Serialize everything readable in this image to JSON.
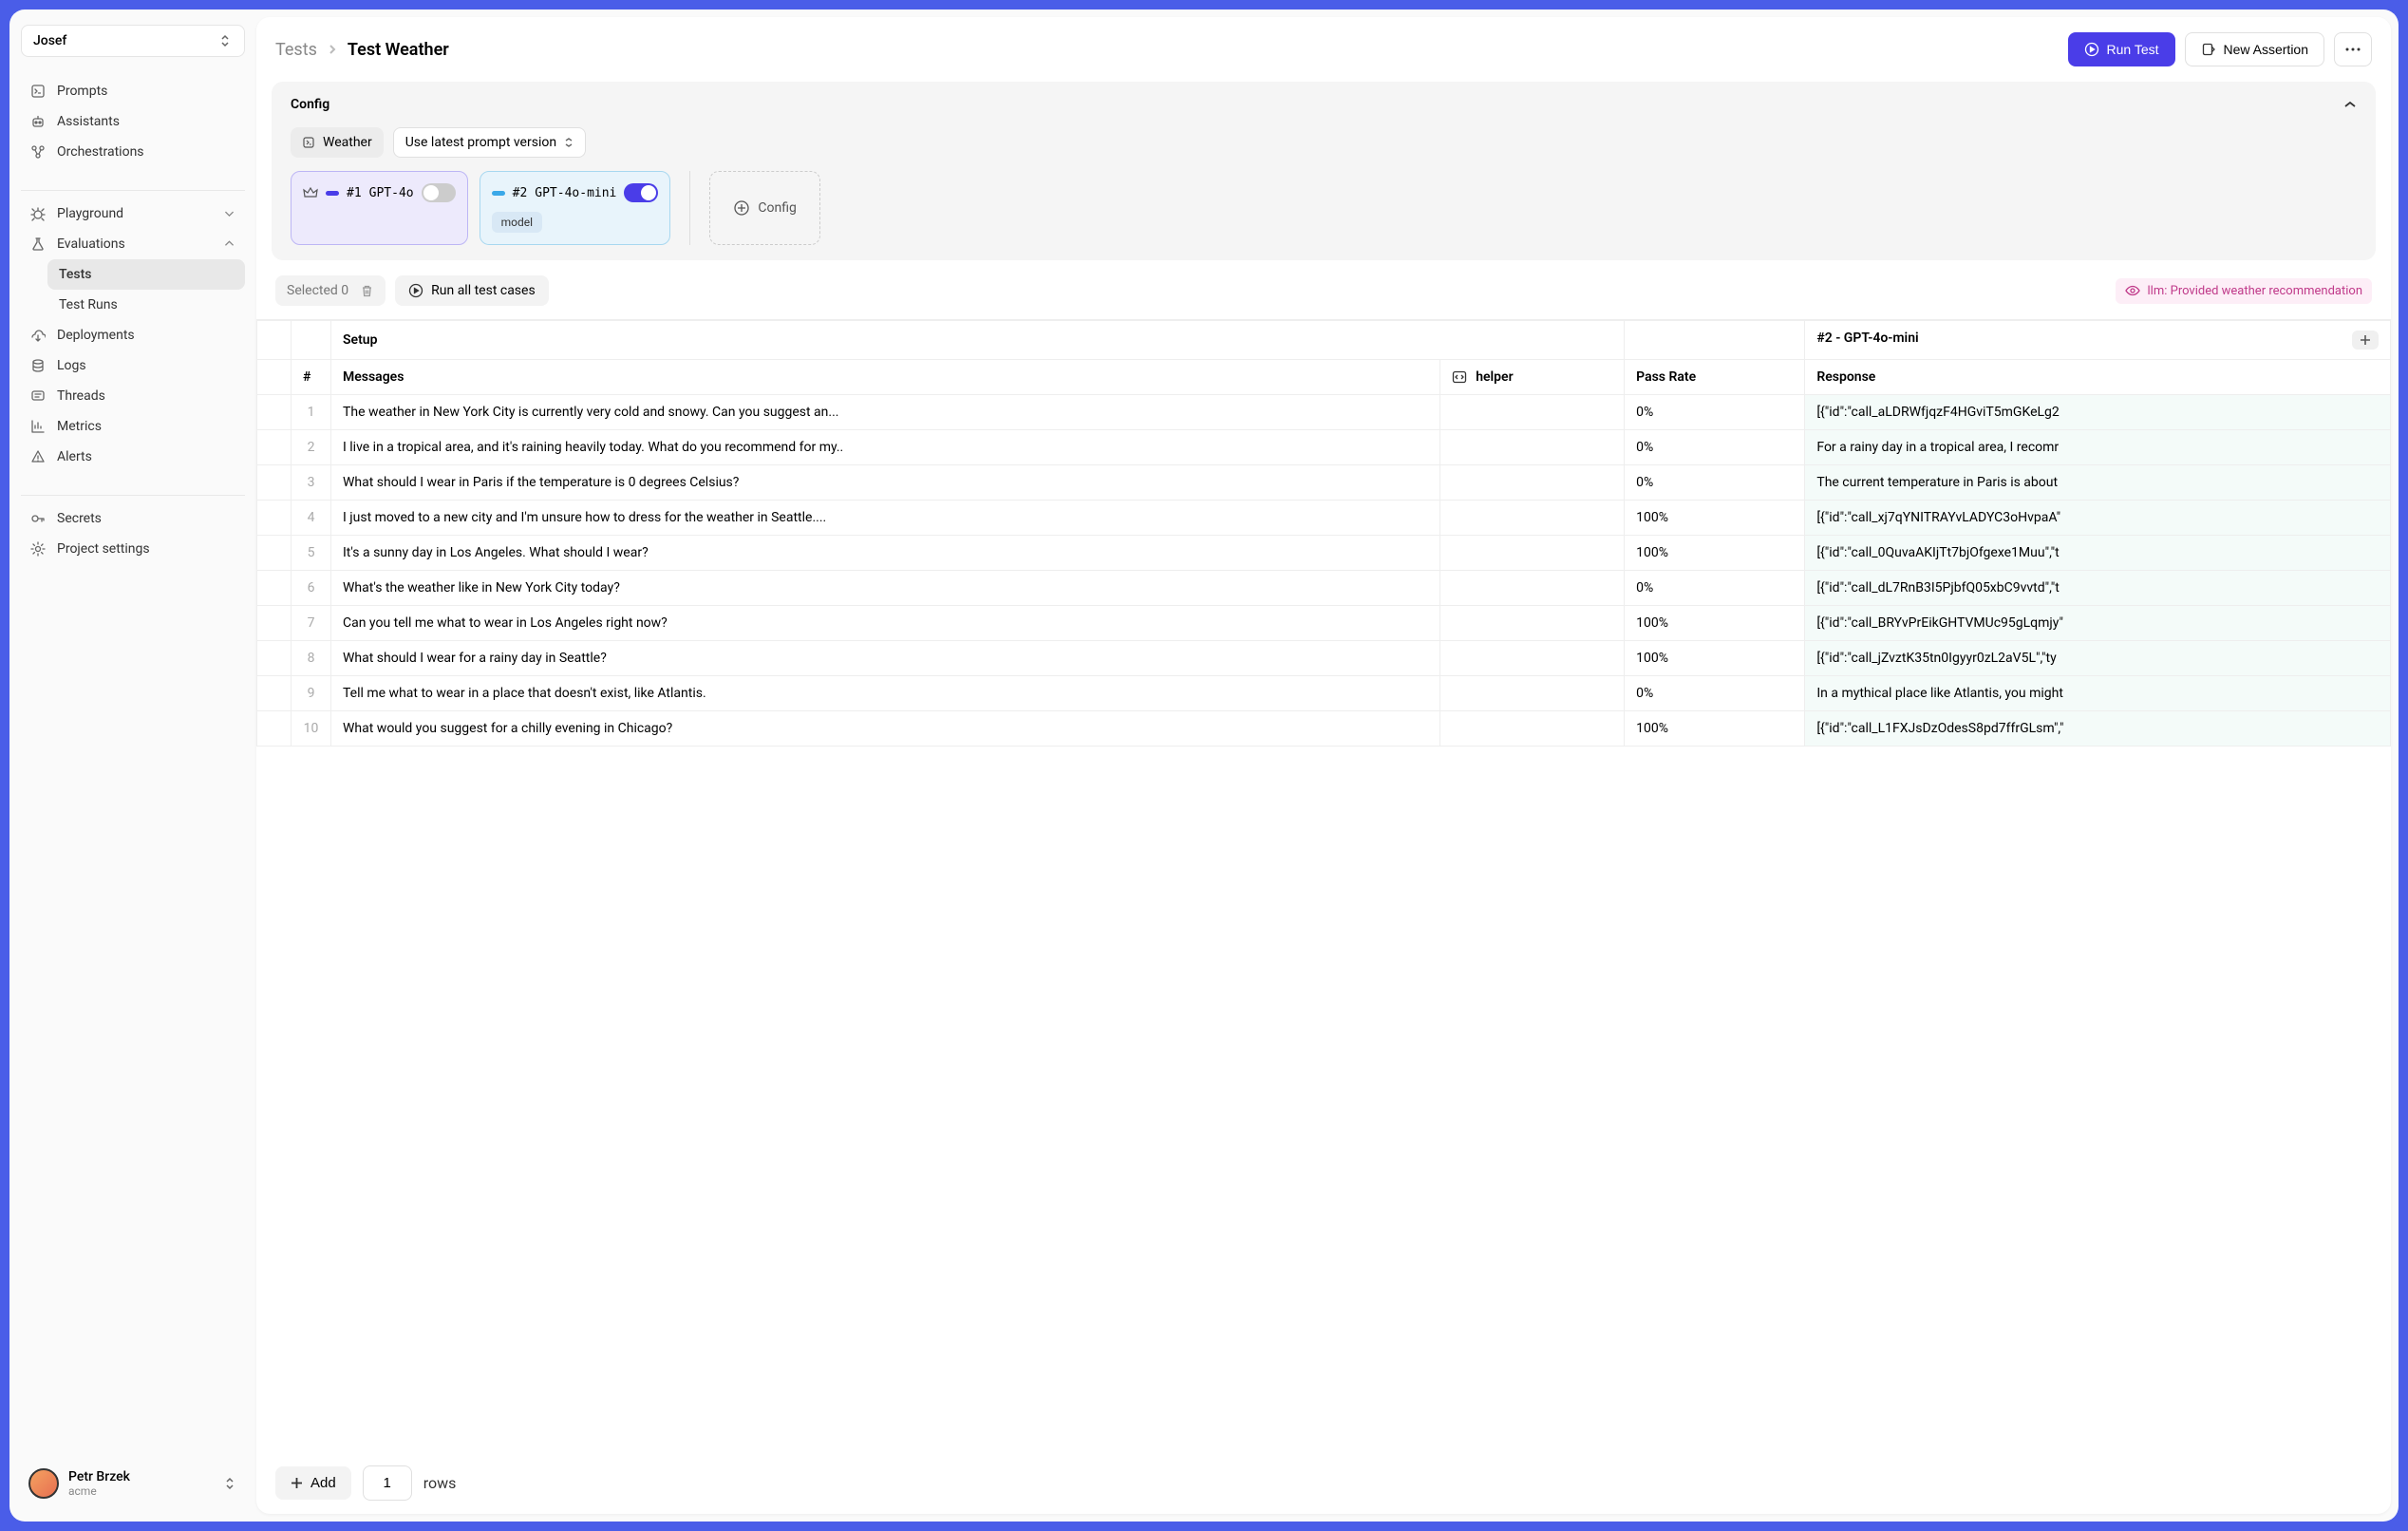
{
  "org": "Josef",
  "sidebar": {
    "primary": [
      {
        "label": "Prompts",
        "icon": "prompt"
      },
      {
        "label": "Assistants",
        "icon": "robot"
      },
      {
        "label": "Orchestrations",
        "icon": "flow"
      }
    ],
    "secondary": [
      {
        "label": "Playground",
        "icon": "bug",
        "chev": "down"
      },
      {
        "label": "Evaluations",
        "icon": "flask",
        "chev": "up",
        "open": true,
        "children": [
          {
            "label": "Tests",
            "active": true
          },
          {
            "label": "Test Runs"
          }
        ]
      },
      {
        "label": "Deployments",
        "icon": "deploy"
      },
      {
        "label": "Logs",
        "icon": "db"
      },
      {
        "label": "Threads",
        "icon": "thread"
      },
      {
        "label": "Metrics",
        "icon": "chart"
      },
      {
        "label": "Alerts",
        "icon": "alert"
      }
    ],
    "tertiary": [
      {
        "label": "Secrets",
        "icon": "key"
      },
      {
        "label": "Project settings",
        "icon": "gear"
      }
    ]
  },
  "footer_user": {
    "name": "Petr Brzek",
    "org": "acme"
  },
  "breadcrumb": {
    "root": "Tests",
    "current": "Test Weather"
  },
  "actions": {
    "run": "Run Test",
    "new_assertion": "New Assertion"
  },
  "config": {
    "title": "Config",
    "prompt_chip": "Weather",
    "version_chip": "Use latest prompt version",
    "cards": [
      {
        "num": "#1",
        "model": "GPT-4o",
        "toggle": false,
        "color": "purple"
      },
      {
        "num": "#2",
        "model": "GPT-4o-mini",
        "toggle": true,
        "color": "blue",
        "tag": "model"
      }
    ],
    "add_label": "Config"
  },
  "bulk": {
    "selected": "Selected 0",
    "run_all": "Run all test cases",
    "llm_badge": "llm: Provided weather recommendation"
  },
  "table": {
    "group1": "Setup",
    "group2": "#2 - GPT-4o-mini",
    "cols": {
      "num": "#",
      "messages": "Messages",
      "helper": "helper",
      "pass": "Pass Rate",
      "response": "Response"
    },
    "rows": [
      {
        "n": "1",
        "msg": "The weather in New York City is currently very cold and snowy. Can you suggest an...",
        "pass": "0%",
        "resp": "[{\"id\":\"call_aLDRWfjqzF4HGviT5mGKeLg2"
      },
      {
        "n": "2",
        "msg": "I live in a tropical area, and it's raining heavily today. What do you recommend for my..",
        "pass": "0%",
        "resp": "For a rainy day in a tropical area, I recomr"
      },
      {
        "n": "3",
        "msg": "What should I wear in Paris if the temperature is 0 degrees Celsius?",
        "pass": "0%",
        "resp": "The current temperature in Paris is about"
      },
      {
        "n": "4",
        "msg": "I just moved to a new city and I'm unsure how to dress for the weather in Seattle....",
        "pass": "100%",
        "resp": "[{\"id\":\"call_xj7qYNITRAYvLADYC3oHvpaA\""
      },
      {
        "n": "5",
        "msg": "It's a sunny day in Los Angeles. What should I wear?",
        "pass": "100%",
        "resp": "[{\"id\":\"call_0QuvaAKIjTt7bjOfgexe1Muu\",\"t"
      },
      {
        "n": "6",
        "msg": "What's the weather like in New York City today?",
        "pass": "0%",
        "resp": "[{\"id\":\"call_dL7RnB3I5PjbfQ05xbC9vvtd\",\"t"
      },
      {
        "n": "7",
        "msg": "Can you tell me what to wear in Los Angeles right now?",
        "pass": "100%",
        "resp": "[{\"id\":\"call_BRYvPrEikGHTVMUc95gLqmjy\""
      },
      {
        "n": "8",
        "msg": "What should I wear for a rainy day in Seattle?",
        "pass": "100%",
        "resp": "[{\"id\":\"call_jZvztK35tn0Igyyr0zL2aV5L\",\"ty"
      },
      {
        "n": "9",
        "msg": "Tell me what to wear in a place that doesn't exist, like Atlantis.",
        "pass": "0%",
        "resp": "In a mythical place like Atlantis, you might"
      },
      {
        "n": "10",
        "msg": "What would you suggest for a chilly evening in Chicago?",
        "pass": "100%",
        "resp": "[{\"id\":\"call_L1FXJsDzOdesS8pd7ffrGLsm\",\""
      }
    ]
  },
  "footer": {
    "add": "Add",
    "rows_value": "1",
    "rows_label": "rows"
  }
}
